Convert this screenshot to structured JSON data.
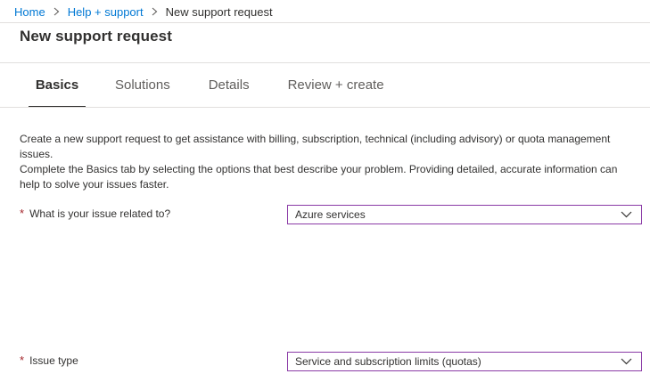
{
  "breadcrumb": {
    "items": [
      "Home",
      "Help + support",
      "New support request"
    ]
  },
  "page": {
    "title": "New support request"
  },
  "tabs": [
    {
      "label": "Basics",
      "active": true
    },
    {
      "label": "Solutions",
      "active": false
    },
    {
      "label": "Details",
      "active": false
    },
    {
      "label": "Review + create",
      "active": false
    }
  ],
  "description": {
    "line1": "Create a new support request to get assistance with billing, subscription, technical (including advisory) or quota management issues.",
    "line2": "Complete the Basics tab by selecting the options that best describe your problem. Providing detailed, accurate information can help to solve your issues faster."
  },
  "form": {
    "required_marker": "*",
    "issue_related": {
      "label": "What is your issue related to?",
      "value": "Azure services"
    },
    "issue_type": {
      "label": "Issue type",
      "value": "Service and subscription limits (quotas)"
    }
  },
  "colors": {
    "link": "#0078d4",
    "required": "#a4262c",
    "dropdown_border": "#8a3aa6",
    "active_tab_underline": "#323130"
  },
  "icons": [
    "chevron-right-icon",
    "chevron-down-icon"
  ]
}
